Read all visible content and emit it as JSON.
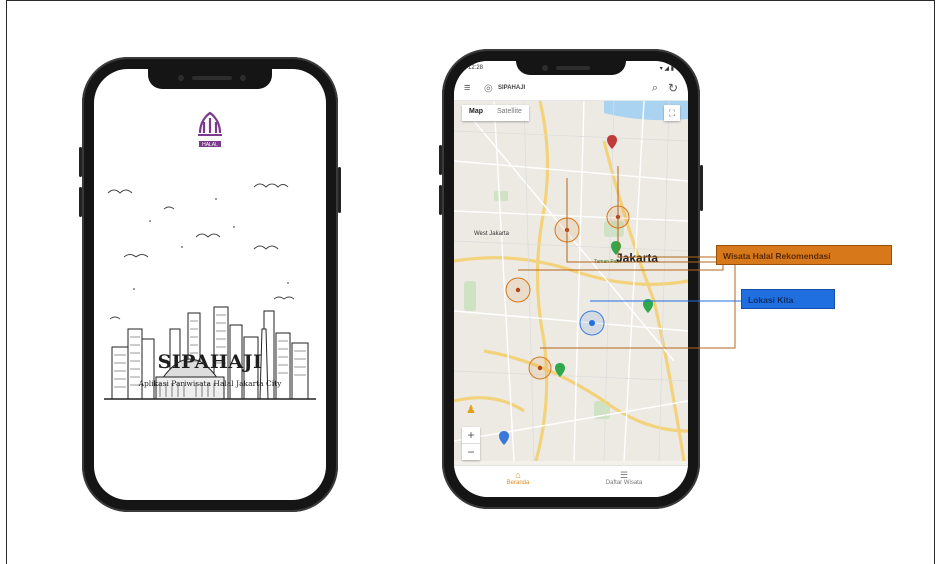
{
  "left_phone": {
    "logo_text": "HALAL",
    "app_title": "SIPAHAJI",
    "app_subtitle": "Aplikasi Pariwisata Halal Jakarta City"
  },
  "right_phone": {
    "status_time": "12:28",
    "status_right": "▾ ◢ ▮",
    "app_brand": "SIPAHAJI",
    "map_type": {
      "options": [
        "Map",
        "Satellite"
      ],
      "selected": "Map"
    },
    "map_labels": {
      "west_jakarta": "West Jakarta",
      "jakarta": "Jakarta",
      "park": "Taman Park",
      "lokasi": "Lokasi Kita"
    },
    "zoom": {
      "plus": "+",
      "minus": "−"
    },
    "bottom_nav": [
      {
        "label": "Beranda",
        "icon": "home-icon",
        "active": true
      },
      {
        "label": "Daftar Wisata",
        "icon": "list-icon",
        "active": false
      }
    ]
  },
  "annotations": {
    "wisata_label": "Wisata Halal Rekomendasi",
    "lokasi_label": "Lokasi Kita"
  },
  "colors": {
    "accent_orange": "#d7781b",
    "accent_blue": "#1f6fe0",
    "halal_purple": "#7b3a8c",
    "phone_body": "#151515"
  }
}
